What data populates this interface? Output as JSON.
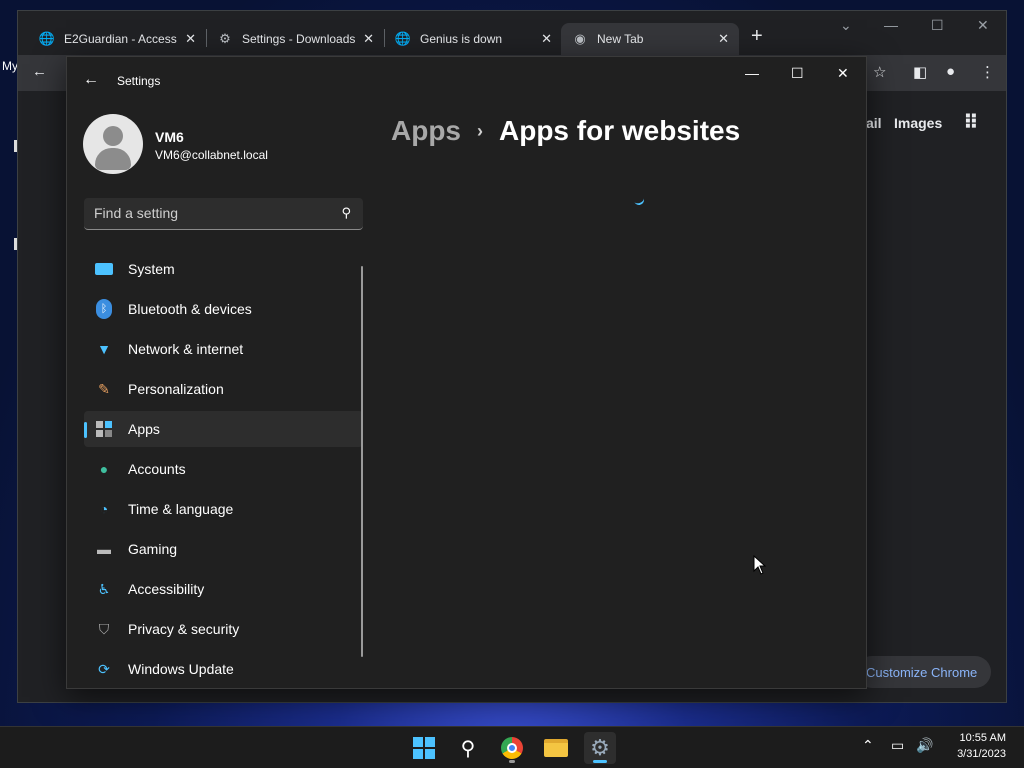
{
  "desktop": {
    "partial_label": "My"
  },
  "browser": {
    "tabs": [
      {
        "title": "E2Guardian - Access",
        "icon": "globe-icon",
        "active": false
      },
      {
        "title": "Settings - Downloads",
        "icon": "gear-icon",
        "active": false
      },
      {
        "title": "Genius is down",
        "icon": "globe-icon",
        "active": false
      },
      {
        "title": "New Tab",
        "icon": "chrome-icon",
        "active": true
      }
    ],
    "google_links": {
      "gmail": "ail",
      "images": "Images"
    },
    "customize_label": "Customize Chrome"
  },
  "settings": {
    "window_title": "Settings",
    "user": {
      "name": "VM6",
      "email": "VM6@collabnet.local"
    },
    "search_placeholder": "Find a setting",
    "nav": [
      {
        "label": "System",
        "icon": "system-icon",
        "selected": false
      },
      {
        "label": "Bluetooth & devices",
        "icon": "bluetooth-icon",
        "selected": false
      },
      {
        "label": "Network & internet",
        "icon": "wifi-icon",
        "selected": false
      },
      {
        "label": "Personalization",
        "icon": "brush-icon",
        "selected": false
      },
      {
        "label": "Apps",
        "icon": "apps-icon",
        "selected": true
      },
      {
        "label": "Accounts",
        "icon": "account-icon",
        "selected": false
      },
      {
        "label": "Time & language",
        "icon": "clock-globe-icon",
        "selected": false
      },
      {
        "label": "Gaming",
        "icon": "gamepad-icon",
        "selected": false
      },
      {
        "label": "Accessibility",
        "icon": "accessibility-icon",
        "selected": false
      },
      {
        "label": "Privacy & security",
        "icon": "shield-icon",
        "selected": false
      },
      {
        "label": "Windows Update",
        "icon": "update-icon",
        "selected": false
      }
    ],
    "breadcrumb": {
      "parent": "Apps",
      "separator": "›",
      "current": "Apps for websites"
    }
  },
  "taskbar": {
    "apps": [
      "start-icon",
      "search-icon",
      "chrome-icon",
      "file-explorer-icon",
      "settings-icon"
    ],
    "time": "10:55 AM",
    "date": "3/31/2023"
  },
  "colors": {
    "accent": "#4cc2ff",
    "settings_bg": "#202020",
    "chrome_bg": "#202124"
  }
}
